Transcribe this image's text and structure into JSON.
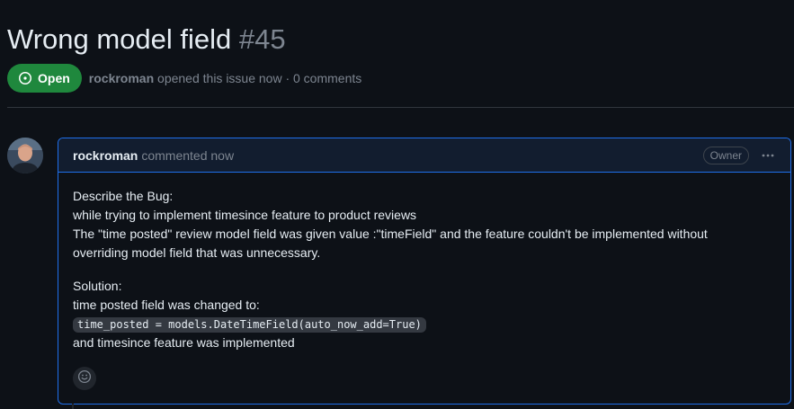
{
  "issue": {
    "title": "Wrong model field",
    "number": "#45",
    "state": "Open",
    "author": "rockroman",
    "meta_suffix": "opened this issue now · 0 comments"
  },
  "comment": {
    "author": "rockroman",
    "time": "commented now",
    "role_label": "Owner",
    "body": {
      "paragraph1": [
        "Describe the Bug:",
        "while trying to implement timesince feature to product reviews",
        "The \"time posted\" review model field was given value :\"timeField\" and the feature couldn't be implemented without",
        "overriding model field that was unnecessary."
      ],
      "solution_heading": "Solution:",
      "solution_line": "time posted field was changed to:",
      "code": "time_posted = models.DateTimeField(auto_now_add=True)",
      "closing_line": "and timesince feature was implemented"
    }
  },
  "colors": {
    "open_green": "#1f883d",
    "accent_blue": "#1f6feb",
    "background": "#0d1117"
  },
  "icons": {
    "state": "issue-opened-icon",
    "menu": "kebab-horizontal-icon",
    "reaction": "smiley-icon"
  }
}
